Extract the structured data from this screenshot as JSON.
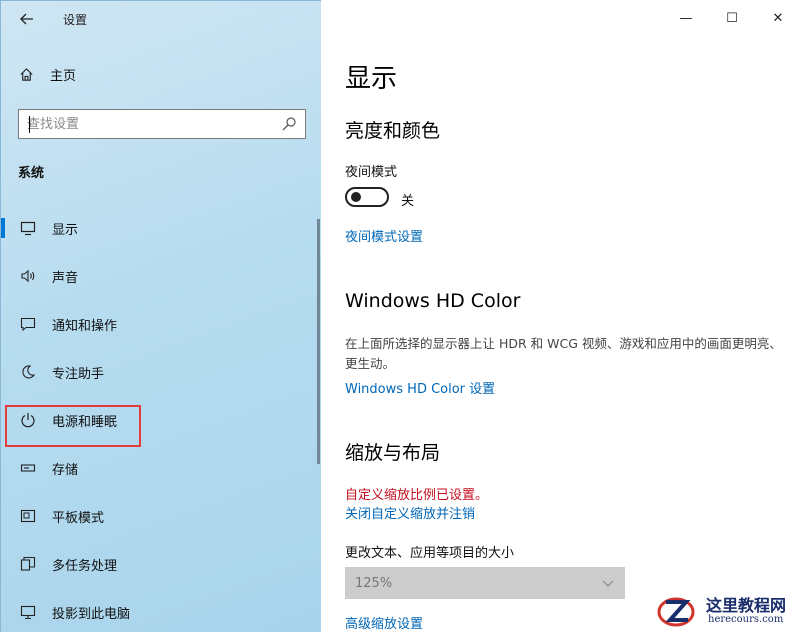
{
  "window": {
    "title": "设置",
    "controls": {
      "minimize": "—",
      "maximize": "☐",
      "close": "✕"
    }
  },
  "sidebar": {
    "home_label": "主页",
    "search_placeholder": "查找设置",
    "section_title": "系统",
    "items": [
      {
        "label": "显示",
        "icon": "monitor-icon",
        "active": true
      },
      {
        "label": "声音",
        "icon": "speaker-icon"
      },
      {
        "label": "通知和操作",
        "icon": "message-icon"
      },
      {
        "label": "专注助手",
        "icon": "moon-icon"
      },
      {
        "label": "电源和睡眠",
        "icon": "power-icon",
        "highlighted": true
      },
      {
        "label": "存储",
        "icon": "storage-icon"
      },
      {
        "label": "平板模式",
        "icon": "tablet-icon"
      },
      {
        "label": "多任务处理",
        "icon": "multitask-icon"
      },
      {
        "label": "投影到此电脑",
        "icon": "project-icon"
      }
    ]
  },
  "main": {
    "title": "显示",
    "brightness": {
      "heading": "亮度和颜色",
      "night_mode_label": "夜间模式",
      "night_mode_state": "关",
      "night_mode_settings_link": "夜间模式设置"
    },
    "hdr": {
      "heading": "Windows HD Color",
      "description": "在上面所选择的显示器上让 HDR 和 WCG 视频、游戏和应用中的画面更明亮、更生动。",
      "settings_link": "Windows HD Color 设置"
    },
    "scale": {
      "heading": "缩放与布局",
      "warning": "自定义缩放比例已设置。",
      "disable_link": "关闭自定义缩放并注销",
      "size_label": "更改文本、应用等项目的大小",
      "size_value": "125%",
      "advanced_link": "高级缩放设置"
    }
  },
  "watermark": {
    "text": "这里教程网",
    "sub": "herecours.com"
  },
  "colors": {
    "accent": "#0078d7",
    "link": "#0067b8",
    "warning": "#c50f1f",
    "highlight_box": "#e23c3c"
  }
}
